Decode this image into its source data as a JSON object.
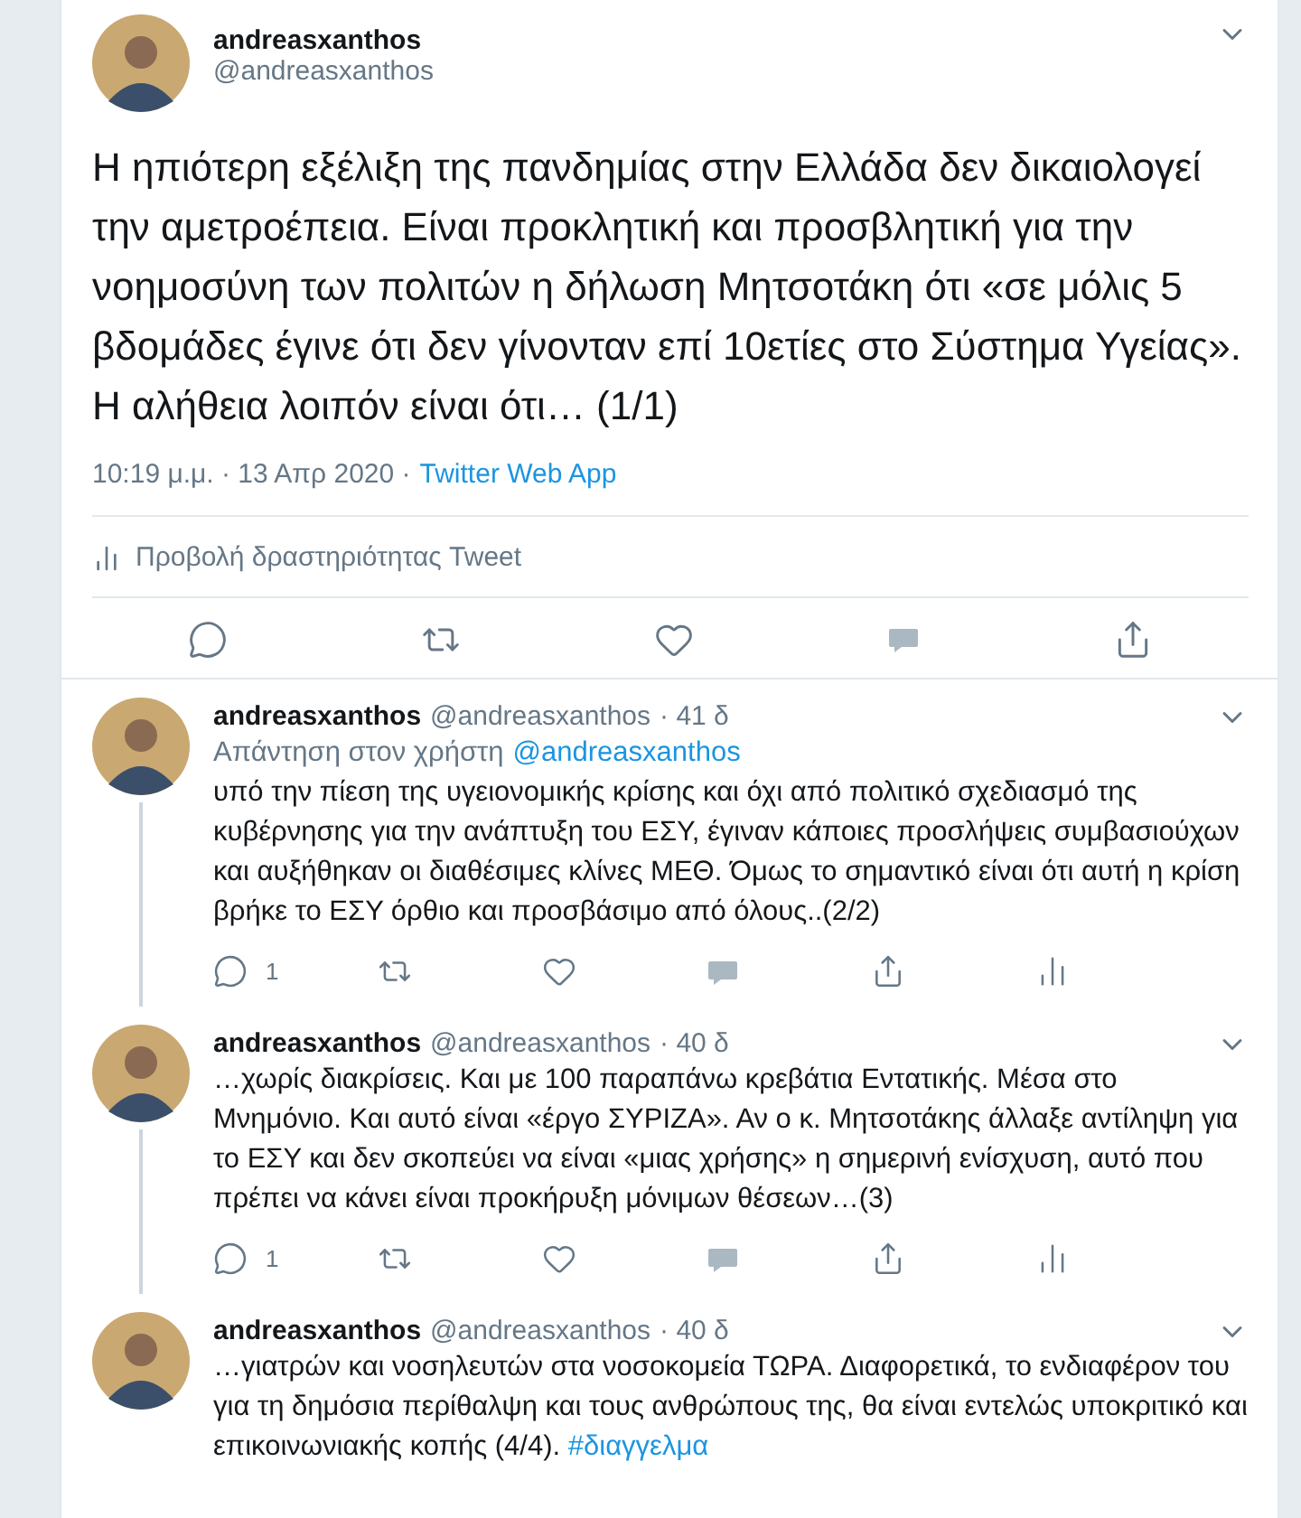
{
  "main_tweet": {
    "display_name": "andreasxanthos",
    "handle": "@andreasxanthos",
    "text": "Η ηπιότερη εξέλιξη της πανδημίας στην Ελλάδα δεν δικαιολογεί την αμετροέπεια. Είναι προκλητική και προσβλητική για την νοημοσύνη των πολιτών η δήλωση Μητσοτάκη ότι «σε μόλις 5 βδομάδες έγινε ότι δεν γίνονταν επί 10ετίες στο Σύστημα Υγείας». Η αλήθεια λοιπόν είναι ότι… (1/1)",
    "timestamp": "10:19 μ.μ. · 13 Απρ 2020 ·",
    "source": "Twitter Web App",
    "activity_link": "Προβολή δραστηριότητας Tweet",
    "actions": [
      {
        "kind": "reply"
      },
      {
        "kind": "retweet"
      },
      {
        "kind": "like"
      },
      {
        "kind": "message"
      },
      {
        "kind": "share"
      }
    ]
  },
  "replies": [
    {
      "display_name": "andreasxanthos",
      "handle": "@andreasxanthos",
      "time": "· 41 δ",
      "reply_to_label": "Απάντηση στον χρήστη",
      "reply_to_handle": "@andreasxanthos",
      "text": "υπό την πίεση της υγειονομικής κρίσης και όχι από πολιτικό σχεδιασμό της κυβέρνησης για την ανάπτυξη του ΕΣΥ, έγιναν κάποιες προσλήψεις συμβασιούχων και αυξήθηκαν οι διαθέσιμες κλίνες ΜΕΘ. Όμως το σημαντικό είναι ότι αυτή η κρίση βρήκε το ΕΣΥ όρθιο και προσβάσιμο από όλους..(2/2)",
      "actions": [
        {
          "kind": "reply",
          "count": "1"
        },
        {
          "kind": "retweet"
        },
        {
          "kind": "like"
        },
        {
          "kind": "message"
        },
        {
          "kind": "share"
        },
        {
          "kind": "analytics"
        }
      ]
    },
    {
      "display_name": "andreasxanthos",
      "handle": "@andreasxanthos",
      "time": "· 40 δ",
      "text": "…χωρίς διακρίσεις. Και με 100 παραπάνω κρεβάτια Εντατικής. Μέσα στο Μνημόνιο. Και αυτό είναι «έργο ΣΥΡΙΖΑ». Αν ο κ. Μητσοτάκης άλλαξε αντίληψη για το ΕΣΥ και δεν σκοπεύει να είναι «μιας χρήσης» η σημερινή ενίσχυση, αυτό που πρέπει να κάνει είναι προκήρυξη μόνιμων θέσεων…(3)",
      "actions": [
        {
          "kind": "reply",
          "count": "1"
        },
        {
          "kind": "retweet"
        },
        {
          "kind": "like"
        },
        {
          "kind": "message"
        },
        {
          "kind": "share"
        },
        {
          "kind": "analytics"
        }
      ]
    },
    {
      "display_name": "andreasxanthos",
      "handle": "@andreasxanthos",
      "time": "· 40 δ",
      "text": "…γιατρών και νοσηλευτών στα νοσοκομεία ΤΩΡΑ. Διαφορετικά, το ενδιαφέρον του για τη δημόσια περίθαλψη και τους ανθρώπους της, θα είναι εντελώς υποκριτικό και επικοινωνιακής κοπής (4/4).",
      "hashtag": "#διαγγελμα"
    }
  ]
}
